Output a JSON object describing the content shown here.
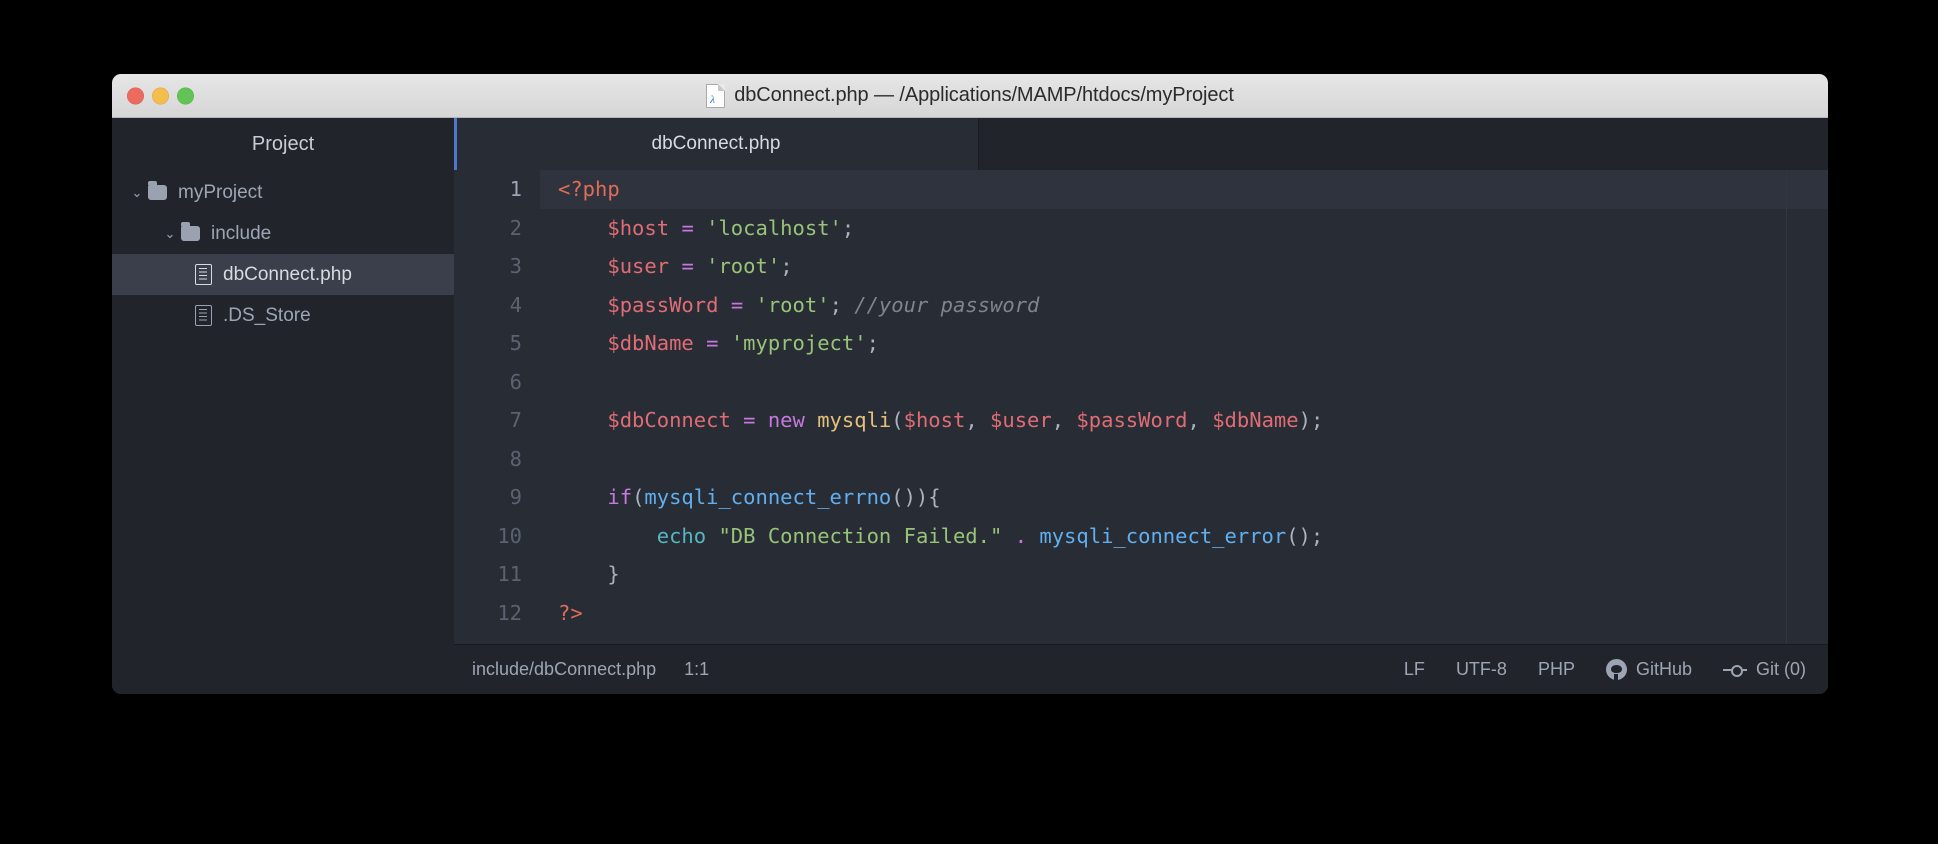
{
  "window": {
    "title": "dbConnect.php — /Applications/MAMP/htdocs/myProject",
    "traffic_lights": {
      "close_color": "#ed6a5e",
      "minimize_color": "#f4be4f",
      "maximize_color": "#61c454"
    }
  },
  "sidebar": {
    "header": "Project",
    "tree": [
      {
        "label": "myProject",
        "type": "folder",
        "depth": 0,
        "expanded": true,
        "chevron": "⌄",
        "selected": false
      },
      {
        "label": "include",
        "type": "folder",
        "depth": 1,
        "expanded": true,
        "chevron": "⌄",
        "selected": false
      },
      {
        "label": "dbConnect.php",
        "type": "file",
        "depth": 2,
        "expanded": false,
        "chevron": "",
        "selected": true
      },
      {
        "label": ".DS_Store",
        "type": "file",
        "depth": 2,
        "expanded": false,
        "chevron": "",
        "selected": false
      }
    ]
  },
  "tabs": [
    {
      "label": "dbConnect.php",
      "active": true
    }
  ],
  "editor": {
    "active_line": 1,
    "lines": [
      {
        "n": "1",
        "tokens": [
          {
            "t": "<?php",
            "c": "tk-tag"
          }
        ]
      },
      {
        "n": "2",
        "tokens": [
          {
            "t": "    ",
            "c": "tk-pun"
          },
          {
            "t": "$host",
            "c": "tk-var"
          },
          {
            "t": " ",
            "c": "tk-pun"
          },
          {
            "t": "=",
            "c": "tk-op"
          },
          {
            "t": " ",
            "c": "tk-pun"
          },
          {
            "t": "'localhost'",
            "c": "tk-str"
          },
          {
            "t": ";",
            "c": "tk-pun"
          }
        ]
      },
      {
        "n": "3",
        "tokens": [
          {
            "t": "    ",
            "c": "tk-pun"
          },
          {
            "t": "$user",
            "c": "tk-var"
          },
          {
            "t": " ",
            "c": "tk-pun"
          },
          {
            "t": "=",
            "c": "tk-op"
          },
          {
            "t": " ",
            "c": "tk-pun"
          },
          {
            "t": "'root'",
            "c": "tk-str"
          },
          {
            "t": ";",
            "c": "tk-pun"
          }
        ]
      },
      {
        "n": "4",
        "tokens": [
          {
            "t": "    ",
            "c": "tk-pun"
          },
          {
            "t": "$passWord",
            "c": "tk-var"
          },
          {
            "t": " ",
            "c": "tk-pun"
          },
          {
            "t": "=",
            "c": "tk-op"
          },
          {
            "t": " ",
            "c": "tk-pun"
          },
          {
            "t": "'root'",
            "c": "tk-str"
          },
          {
            "t": "; ",
            "c": "tk-pun"
          },
          {
            "t": "//your password",
            "c": "tk-com"
          }
        ]
      },
      {
        "n": "5",
        "tokens": [
          {
            "t": "    ",
            "c": "tk-pun"
          },
          {
            "t": "$dbName",
            "c": "tk-var"
          },
          {
            "t": " ",
            "c": "tk-pun"
          },
          {
            "t": "=",
            "c": "tk-op"
          },
          {
            "t": " ",
            "c": "tk-pun"
          },
          {
            "t": "'myproject'",
            "c": "tk-str"
          },
          {
            "t": ";",
            "c": "tk-pun"
          }
        ]
      },
      {
        "n": "6",
        "tokens": []
      },
      {
        "n": "7",
        "tokens": [
          {
            "t": "    ",
            "c": "tk-pun"
          },
          {
            "t": "$dbConnect",
            "c": "tk-var"
          },
          {
            "t": " ",
            "c": "tk-pun"
          },
          {
            "t": "=",
            "c": "tk-op"
          },
          {
            "t": " ",
            "c": "tk-pun"
          },
          {
            "t": "new",
            "c": "tk-kw"
          },
          {
            "t": " ",
            "c": "tk-pun"
          },
          {
            "t": "mysqli",
            "c": "tk-cls"
          },
          {
            "t": "(",
            "c": "tk-pun"
          },
          {
            "t": "$host",
            "c": "tk-var"
          },
          {
            "t": ", ",
            "c": "tk-pun"
          },
          {
            "t": "$user",
            "c": "tk-var"
          },
          {
            "t": ", ",
            "c": "tk-pun"
          },
          {
            "t": "$passWord",
            "c": "tk-var"
          },
          {
            "t": ", ",
            "c": "tk-pun"
          },
          {
            "t": "$dbName",
            "c": "tk-var"
          },
          {
            "t": ");",
            "c": "tk-pun"
          }
        ]
      },
      {
        "n": "8",
        "tokens": []
      },
      {
        "n": "9",
        "tokens": [
          {
            "t": "    ",
            "c": "tk-pun"
          },
          {
            "t": "if",
            "c": "tk-kw"
          },
          {
            "t": "(",
            "c": "tk-pun"
          },
          {
            "t": "mysqli_connect_errno",
            "c": "tk-fn"
          },
          {
            "t": "()){",
            "c": "tk-pun"
          }
        ]
      },
      {
        "n": "10",
        "tokens": [
          {
            "t": "        ",
            "c": "tk-pun"
          },
          {
            "t": "echo",
            "c": "tk-echo"
          },
          {
            "t": " ",
            "c": "tk-pun"
          },
          {
            "t": "\"DB Connection Failed.\"",
            "c": "tk-str"
          },
          {
            "t": " ",
            "c": "tk-pun"
          },
          {
            "t": ".",
            "c": "tk-op"
          },
          {
            "t": " ",
            "c": "tk-pun"
          },
          {
            "t": "mysqli_connect_error",
            "c": "tk-fn"
          },
          {
            "t": "();",
            "c": "tk-pun"
          }
        ]
      },
      {
        "n": "11",
        "tokens": [
          {
            "t": "    }",
            "c": "tk-pun"
          }
        ]
      },
      {
        "n": "12",
        "tokens": [
          {
            "t": "?>",
            "c": "tk-tag"
          }
        ]
      }
    ]
  },
  "statusbar": {
    "file_path": "include/dbConnect.php",
    "cursor_position": "1:1",
    "line_ending": "LF",
    "encoding": "UTF-8",
    "grammar": "PHP",
    "github": "GitHub",
    "git": "Git (0)"
  },
  "colors": {
    "editor_bg": "#282c34",
    "chrome_bg": "#21252b",
    "selected_row": "#3a3f4b",
    "active_line": "#2f333d",
    "accent_blue": "#4d78cc",
    "text_primary": "#d7dae0",
    "text_muted": "#9da5b4"
  }
}
